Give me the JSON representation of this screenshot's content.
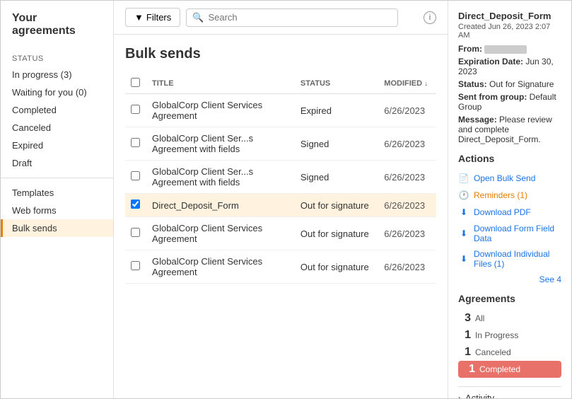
{
  "app": {
    "title": "Your agreements"
  },
  "toolbar": {
    "filter_label": "Filters",
    "search_placeholder": "Search",
    "info_symbol": "i"
  },
  "sidebar": {
    "status_label": "STATUS",
    "items": [
      {
        "id": "in-progress",
        "label": "In progress (3)"
      },
      {
        "id": "waiting",
        "label": "Waiting for you (0)"
      },
      {
        "id": "completed",
        "label": "Completed"
      },
      {
        "id": "canceled",
        "label": "Canceled"
      },
      {
        "id": "expired",
        "label": "Expired"
      },
      {
        "id": "draft",
        "label": "Draft"
      }
    ],
    "secondary_items": [
      {
        "id": "templates",
        "label": "Templates"
      },
      {
        "id": "web-forms",
        "label": "Web forms"
      },
      {
        "id": "bulk-sends",
        "label": "Bulk sends"
      }
    ]
  },
  "main": {
    "page_title": "Bulk sends",
    "table": {
      "columns": [
        {
          "id": "checkbox",
          "label": ""
        },
        {
          "id": "title",
          "label": "TITLE"
        },
        {
          "id": "status",
          "label": "STATUS"
        },
        {
          "id": "modified",
          "label": "MODIFIED"
        }
      ],
      "rows": [
        {
          "id": 1,
          "title": "GlobalCorp Client Services Agreement",
          "status": "Expired",
          "modified": "6/26/2023",
          "selected": false
        },
        {
          "id": 2,
          "title": "GlobalCorp Client Ser...s Agreement with fields",
          "status": "Signed",
          "modified": "6/26/2023",
          "selected": false
        },
        {
          "id": 3,
          "title": "GlobalCorp Client Ser...s Agreement with fields",
          "status": "Signed",
          "modified": "6/26/2023",
          "selected": false
        },
        {
          "id": 4,
          "title": "Direct_Deposit_Form",
          "status": "Out for signature",
          "modified": "6/26/2023",
          "selected": true
        },
        {
          "id": 5,
          "title": "GlobalCorp Client Services Agreement",
          "status": "Out for signature",
          "modified": "6/26/2023",
          "selected": false
        },
        {
          "id": 6,
          "title": "GlobalCorp Client Services Agreement",
          "status": "Out for signature",
          "modified": "6/26/2023",
          "selected": false
        }
      ]
    }
  },
  "right_panel": {
    "doc_title": "Direct_Deposit_Form",
    "created": "Created Jun 26, 2023 2:07 AM",
    "from_label": "From:",
    "from_value": "",
    "expiration_label": "Expiration Date:",
    "expiration_value": "Jun 30, 2023",
    "status_label": "Status:",
    "status_value": "Out for Signature",
    "sent_from_group_label": "Sent from group:",
    "sent_from_group_value": "Default Group",
    "message_label": "Message:",
    "message_value": "Please review and complete Direct_Deposit_Form.",
    "actions_title": "Actions",
    "actions": [
      {
        "id": "open-bulk-send",
        "label": "Open Bulk Send",
        "icon": "open"
      },
      {
        "id": "reminders",
        "label": "Reminders (1)",
        "icon": "clock",
        "highlight": true
      },
      {
        "id": "download-pdf",
        "label": "Download PDF",
        "icon": "download"
      },
      {
        "id": "download-form-field",
        "label": "Download Form Field Data",
        "icon": "download"
      },
      {
        "id": "download-individual",
        "label": "Download Individual Files (1)",
        "icon": "download"
      }
    ],
    "see_all": "See 4",
    "agreements_title": "Agreements",
    "agreement_stats": [
      {
        "id": "all",
        "count": "3",
        "label": "All",
        "highlighted": false
      },
      {
        "id": "in-progress",
        "count": "1",
        "label": "In Progress",
        "highlighted": false
      },
      {
        "id": "canceled",
        "count": "1",
        "label": "Canceled",
        "highlighted": false
      },
      {
        "id": "completed",
        "count": "1",
        "label": "Completed",
        "highlighted": true
      }
    ],
    "activity_label": "Activity"
  }
}
